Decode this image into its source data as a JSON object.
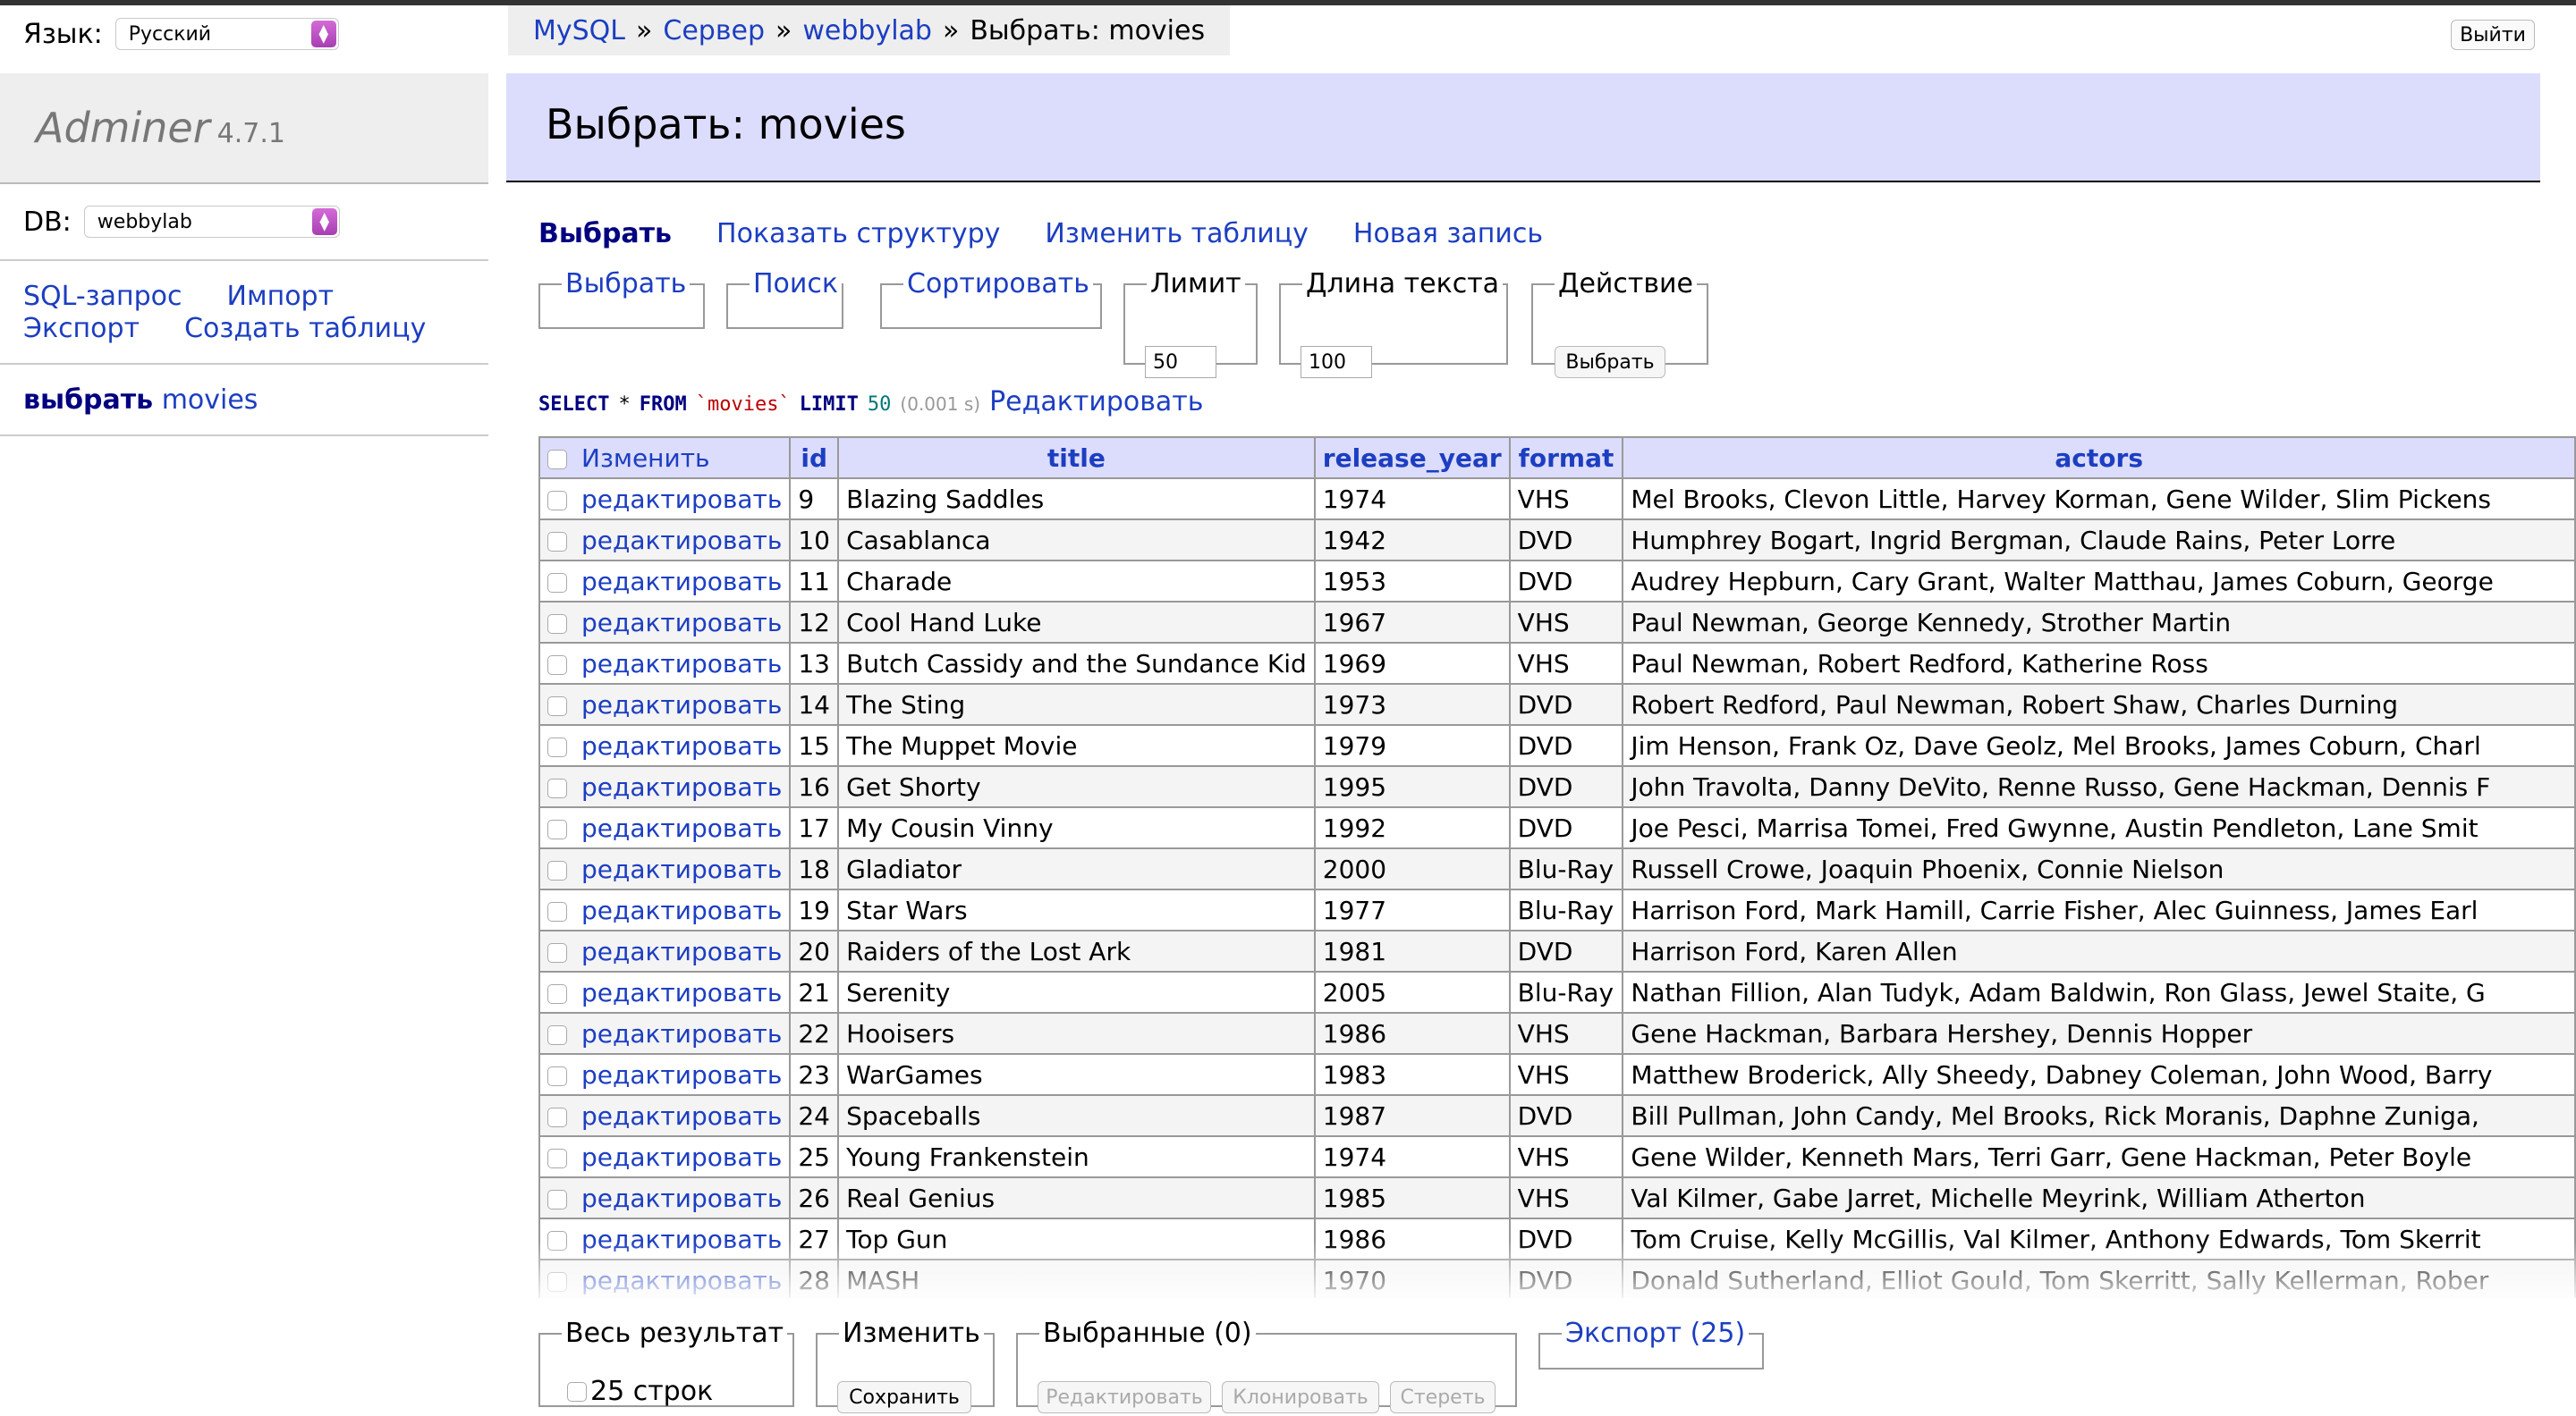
{
  "sidebar": {
    "lang_label": "Язык:",
    "lang_value": "Русский",
    "logo": "Adminer",
    "version": "4.7.1",
    "db_label": "DB:",
    "db_value": "webbylab",
    "links": {
      "sql": "SQL-запрос",
      "import": "Импорт",
      "export": "Экспорт",
      "create_table": "Создать таблицу"
    },
    "table_select_bold": "выбрать",
    "table_name": "movies"
  },
  "header": {
    "breadcrumb": {
      "mysql": "MySQL",
      "sep": "»",
      "server": "Сервер",
      "db": "webbylab",
      "current": "Выбрать: movies"
    },
    "logout": "Выйти",
    "title": "Выбрать: movies"
  },
  "tabs": {
    "select": "Выбрать",
    "structure": "Показать структуру",
    "alter": "Изменить таблицу",
    "new": "Новая запись"
  },
  "filters": {
    "select": "Выбрать",
    "search": "Поиск",
    "sort": "Сортировать",
    "limit_label": "Лимит",
    "limit_value": "50",
    "textlen_label": "Длина текста",
    "textlen_value": "100",
    "action_label": "Действие",
    "action_button": "Выбрать"
  },
  "query": {
    "select": "SELECT",
    "star": "*",
    "from": "FROM",
    "table": "`movies`",
    "limit": "LIMIT",
    "limit_n": "50",
    "time": "(0.001 s)",
    "edit": "Редактировать"
  },
  "table": {
    "columns": {
      "edit": "Изменить",
      "id": "id",
      "title": "title",
      "release_year": "release_year",
      "format": "format",
      "actors": "actors"
    },
    "edit_label": "редактировать",
    "rows": [
      {
        "id": "9",
        "title": "Blazing Saddles",
        "year": "1974",
        "format": "VHS",
        "actors": "Mel Brooks, Clevon Little, Harvey Korman, Gene Wilder, Slim Pickens"
      },
      {
        "id": "10",
        "title": "Casablanca",
        "year": "1942",
        "format": "DVD",
        "actors": "Humphrey Bogart, Ingrid Bergman, Claude Rains, Peter Lorre"
      },
      {
        "id": "11",
        "title": "Charade",
        "year": "1953",
        "format": "DVD",
        "actors": "Audrey Hepburn, Cary Grant, Walter Matthau, James Coburn, George"
      },
      {
        "id": "12",
        "title": "Cool Hand Luke",
        "year": "1967",
        "format": "VHS",
        "actors": "Paul Newman, George Kennedy, Strother Martin"
      },
      {
        "id": "13",
        "title": "Butch Cassidy and the Sundance Kid",
        "year": "1969",
        "format": "VHS",
        "actors": "Paul Newman, Robert Redford, Katherine Ross"
      },
      {
        "id": "14",
        "title": "The Sting",
        "year": "1973",
        "format": "DVD",
        "actors": "Robert Redford, Paul Newman, Robert Shaw, Charles Durning"
      },
      {
        "id": "15",
        "title": "The Muppet Movie",
        "year": "1979",
        "format": "DVD",
        "actors": "Jim Henson, Frank Oz, Dave Geolz, Mel Brooks, James Coburn, Charl"
      },
      {
        "id": "16",
        "title": "Get Shorty",
        "year": "1995",
        "format": "DVD",
        "actors": "John Travolta, Danny DeVito, Renne Russo, Gene Hackman, Dennis F"
      },
      {
        "id": "17",
        "title": "My Cousin Vinny",
        "year": "1992",
        "format": "DVD",
        "actors": "Joe Pesci, Marrisa Tomei, Fred Gwynne, Austin Pendleton, Lane Smit"
      },
      {
        "id": "18",
        "title": "Gladiator",
        "year": "2000",
        "format": "Blu-Ray",
        "actors": "Russell Crowe, Joaquin Phoenix, Connie Nielson"
      },
      {
        "id": "19",
        "title": "Star Wars",
        "year": "1977",
        "format": "Blu-Ray",
        "actors": "Harrison Ford, Mark Hamill, Carrie Fisher, Alec Guinness, James Earl"
      },
      {
        "id": "20",
        "title": "Raiders of the Lost Ark",
        "year": "1981",
        "format": "DVD",
        "actors": "Harrison Ford, Karen Allen"
      },
      {
        "id": "21",
        "title": "Serenity",
        "year": "2005",
        "format": "Blu-Ray",
        "actors": "Nathan Fillion, Alan Tudyk, Adam Baldwin, Ron Glass, Jewel Staite, G"
      },
      {
        "id": "22",
        "title": "Hooisers",
        "year": "1986",
        "format": "VHS",
        "actors": "Gene Hackman, Barbara Hershey, Dennis Hopper"
      },
      {
        "id": "23",
        "title": "WarGames",
        "year": "1983",
        "format": "VHS",
        "actors": "Matthew Broderick, Ally Sheedy, Dabney Coleman, John Wood, Barry"
      },
      {
        "id": "24",
        "title": "Spaceballs",
        "year": "1987",
        "format": "DVD",
        "actors": "Bill Pullman, John Candy, Mel Brooks, Rick Moranis, Daphne Zuniga,"
      },
      {
        "id": "25",
        "title": "Young Frankenstein",
        "year": "1974",
        "format": "VHS",
        "actors": "Gene Wilder, Kenneth Mars, Terri Garr, Gene Hackman, Peter Boyle"
      },
      {
        "id": "26",
        "title": "Real Genius",
        "year": "1985",
        "format": "VHS",
        "actors": "Val Kilmer, Gabe Jarret, Michelle Meyrink, William Atherton"
      },
      {
        "id": "27",
        "title": "Top Gun",
        "year": "1986",
        "format": "DVD",
        "actors": "Tom Cruise, Kelly McGillis, Val Kilmer, Anthony Edwards, Tom Skerrit"
      },
      {
        "id": "28",
        "title": "MASH",
        "year": "1970",
        "format": "DVD",
        "actors": "Donald Sutherland, Elliot Gould, Tom Skerritt, Sally Kellerman, Rober"
      }
    ]
  },
  "bottom": {
    "all_label": "Весь результат",
    "rows_count": "25 строк",
    "modify_label": "Изменить",
    "save": "Сохранить",
    "selected_label": "Выбранные (0)",
    "edit": "Редактировать",
    "clone": "Клонировать",
    "delete": "Стереть",
    "export": "Экспорт (25)"
  }
}
